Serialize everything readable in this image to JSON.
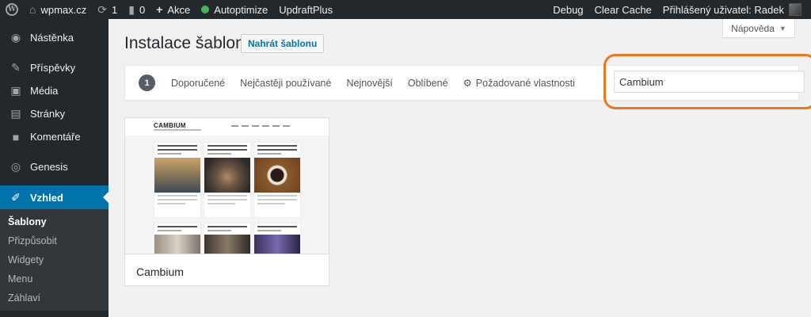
{
  "adminbar": {
    "wp_logo_label": "W",
    "site_name": "wpmax.cz",
    "updates_count": "1",
    "comments_count": "0",
    "new_label": "Akce",
    "autoptimize_label": "Autoptimize",
    "updraft_label": "UpdraftPlus",
    "debug_label": "Debug",
    "clear_cache_label": "Clear Cache",
    "user_label": "Přihlášený uživatel: Radek"
  },
  "sidebar": {
    "items": [
      {
        "label": "Nástěnka",
        "icon": "dashboard-icon"
      },
      {
        "label": "Příspěvky",
        "icon": "pin-icon"
      },
      {
        "label": "Média",
        "icon": "media-icon"
      },
      {
        "label": "Stránky",
        "icon": "page-icon"
      },
      {
        "label": "Komentáře",
        "icon": "comment-icon"
      },
      {
        "label": "Genesis",
        "icon": "genesis-icon"
      },
      {
        "label": "Vzhled",
        "icon": "brush-icon"
      }
    ],
    "submenu": [
      "Šablony",
      "Přizpůsobit",
      "Widgety",
      "Menu",
      "Záhlaví"
    ]
  },
  "header": {
    "help_label": "Nápověda",
    "title": "Instalace šablon",
    "upload_label": "Nahrát šablonu"
  },
  "filter": {
    "count": "1",
    "links": [
      "Doporučené",
      "Nejčastěji používané",
      "Nejnovější",
      "Oblíbené",
      "Požadované vlastnosti"
    ],
    "search_value": "Cambium"
  },
  "theme": {
    "name": "Cambium",
    "screenshot_logo": "CAMBIUM"
  },
  "colors": {
    "adminbar": "#23282d",
    "accent": "#0073aa",
    "highlight_ring": "#e8771f"
  }
}
